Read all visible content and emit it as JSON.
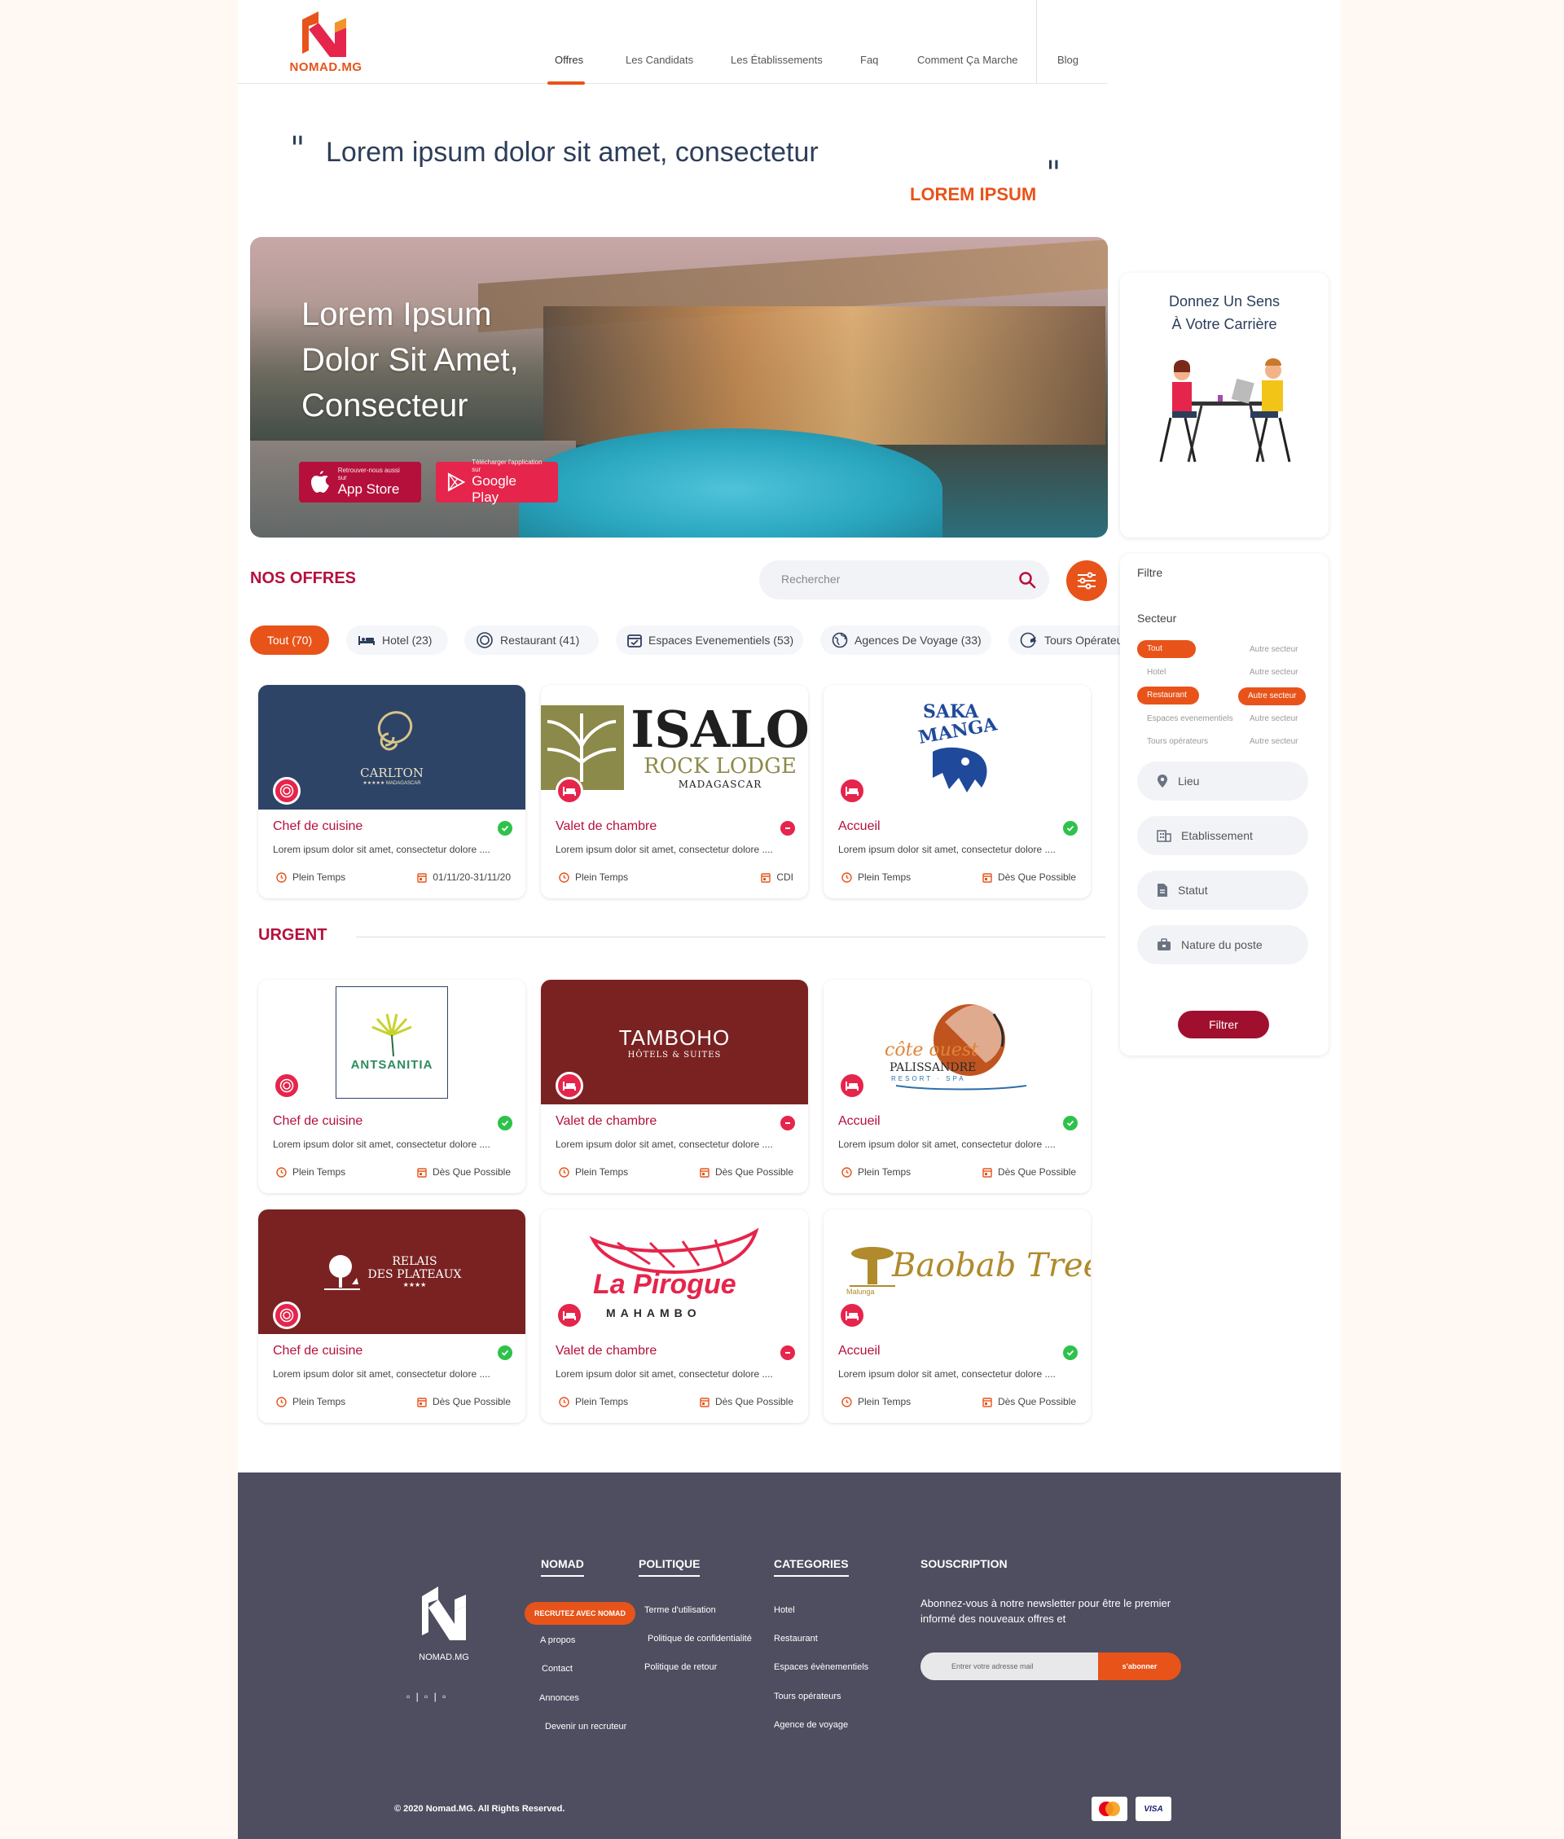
{
  "brand": {
    "name": "NOMAD.MG",
    "accent": "#e8531a",
    "primary": "#b5103c",
    "dark": "#2c3e5a"
  },
  "nav": {
    "items": [
      "Offres",
      "Les Candidats",
      "Les Établissements",
      "Faq",
      "Comment Ça Marche",
      "Blog"
    ],
    "active": "Offres"
  },
  "quote": {
    "open": "\"",
    "text": "Lorem ipsum dolor sit amet, consectetur",
    "close": "\"",
    "author": "LOREM IPSUM"
  },
  "hero": {
    "title_lines": [
      "Lorem Ipsum",
      "Dolor Sit Amet,",
      "Consecteur"
    ],
    "appstore_small": "Retrouver-nous aussi sur",
    "appstore_big": "App Store",
    "google_small": "Télécharger l'application sur",
    "google_big": "Google Play"
  },
  "offers": {
    "title": "NOS OFFRES",
    "search_placeholder": "Rechercher",
    "categories": [
      "Tout (70)",
      "Hotel (23)",
      "Restaurant (41)",
      "Espaces Evenementiels (53)",
      "Agences De Voyage (33)",
      "Tours Opérateurs"
    ],
    "active_category": "Tout (70)"
  },
  "cards": [
    {
      "logo": "CARLTON",
      "logo_sub": "★★★★★  MADAGASCAR",
      "title": "Chef de cuisine",
      "status": "ok",
      "desc": "Lorem ipsum dolor sit amet, consectetur dolore ....",
      "contract": "Plein Temps",
      "date": "01/11/20-31/11/20",
      "badge": "restaurant"
    },
    {
      "logo": "ISALO",
      "logo_sub": "ROCK LODGE",
      "logo_sub2": "MADAGASCAR",
      "title": "Valet de chambre",
      "status": "no",
      "desc": "Lorem ipsum dolor sit amet, consectetur dolore ....",
      "contract": "Plein Temps",
      "date": "CDI",
      "badge": "hotel"
    },
    {
      "logo": "SAKAMANGA",
      "title": "Accueil",
      "status": "ok",
      "desc": "Lorem ipsum dolor sit amet, consectetur dolore ....",
      "contract": "Plein Temps",
      "date": "Dès Que Possible",
      "badge": "hotel"
    },
    {
      "logo": "ANTSANITIA",
      "title": "Chef de cuisine",
      "status": "ok",
      "desc": "Lorem ipsum dolor sit amet, consectetur dolore ....",
      "contract": "Plein Temps",
      "date": "Dès Que Possible",
      "badge": "restaurant"
    },
    {
      "logo": "TAMBOHO",
      "logo_sub": "HÔTELS & SUITES",
      "title": "Valet de chambre",
      "status": "no",
      "desc": "Lorem ipsum dolor sit amet, consectetur dolore ....",
      "contract": "Plein Temps",
      "date": "Dès Que Possible",
      "badge": "hotel"
    },
    {
      "logo": "côte ouest",
      "logo_sub": "PALISSANDRE",
      "logo_sub2": "RESORT · SPA",
      "title": "Accueil",
      "status": "ok",
      "desc": "Lorem ipsum dolor sit amet, consectetur dolore ....",
      "contract": "Plein Temps",
      "date": "Dès Que Possible",
      "badge": "hotel"
    },
    {
      "logo": "RELAIS",
      "logo_sub": "DES PLATEAUX",
      "title": "Chef de cuisine",
      "status": "ok",
      "desc": "Lorem ipsum dolor sit amet, consectetur dolore ....",
      "contract": "Plein Temps",
      "date": "Dès Que Possible",
      "badge": "restaurant"
    },
    {
      "logo": "La Pirogue",
      "logo_sub": "MAHAMBO",
      "title": "Valet de chambre",
      "status": "no",
      "desc": "Lorem ipsum dolor sit amet, consectetur dolore ....",
      "contract": "Plein Temps",
      "date": "Dès Que Possible",
      "badge": "hotel"
    },
    {
      "logo": "Baobab Tree",
      "logo_sub": "Malunga",
      "title": "Accueil",
      "status": "ok",
      "desc": "Lorem ipsum dolor sit amet, consectetur dolore ....",
      "contract": "Plein Temps",
      "date": "Dès Que Possible",
      "badge": "hotel"
    }
  ],
  "urgent": {
    "title": "URGENT"
  },
  "sidebar": {
    "promo_title": "Donnez Un Sens\nÀ Votre Carrière",
    "filter_label": "Filtre",
    "sector_label": "Secteur",
    "sectors_left": [
      "Tout",
      "Hotel",
      "Restaurant",
      "Espaces evenementiels",
      "Tours opérateurs"
    ],
    "sectors_right": [
      "Autre secteur",
      "Autre secteur",
      "Autre secteur",
      "Autre secteur",
      "Autre secteur"
    ],
    "fields": [
      "Lieu",
      "Etablissement",
      "Statut",
      "Nature du poste"
    ],
    "button": "Filtrer"
  },
  "footer": {
    "logo_text": "NOMAD.MG",
    "social": "▫ | ▫ | ▫",
    "col_nomad": {
      "title": "NOMAD",
      "recruit": "RECRUTEZ AVEC NOMAD",
      "links": [
        "A propos",
        "Contact",
        "Annonces",
        "Devenir un recruteur"
      ]
    },
    "col_politique": {
      "title": "POLITIQUE",
      "links": [
        "Terme d'utilisation",
        "Politique de  confidentialité",
        "Politique de retour"
      ]
    },
    "col_categories": {
      "title": "CATEGORIES",
      "links": [
        "Hotel",
        "Restaurant",
        "Espaces évènementiels",
        "Tours opérateurs",
        "Agence de voyage"
      ]
    },
    "col_sub": {
      "title": "SOUSCRIPTION",
      "text": "Abonnez-vous à notre newsletter pour être le premier informé des nouveaux offres et",
      "placeholder": "Entrer votre adresse mail",
      "button": "s'abonner"
    },
    "copyright": "© 2020 Nomad.MG. All Rights Reserved.",
    "payments": [
      "MasterCard",
      "VISA"
    ]
  }
}
